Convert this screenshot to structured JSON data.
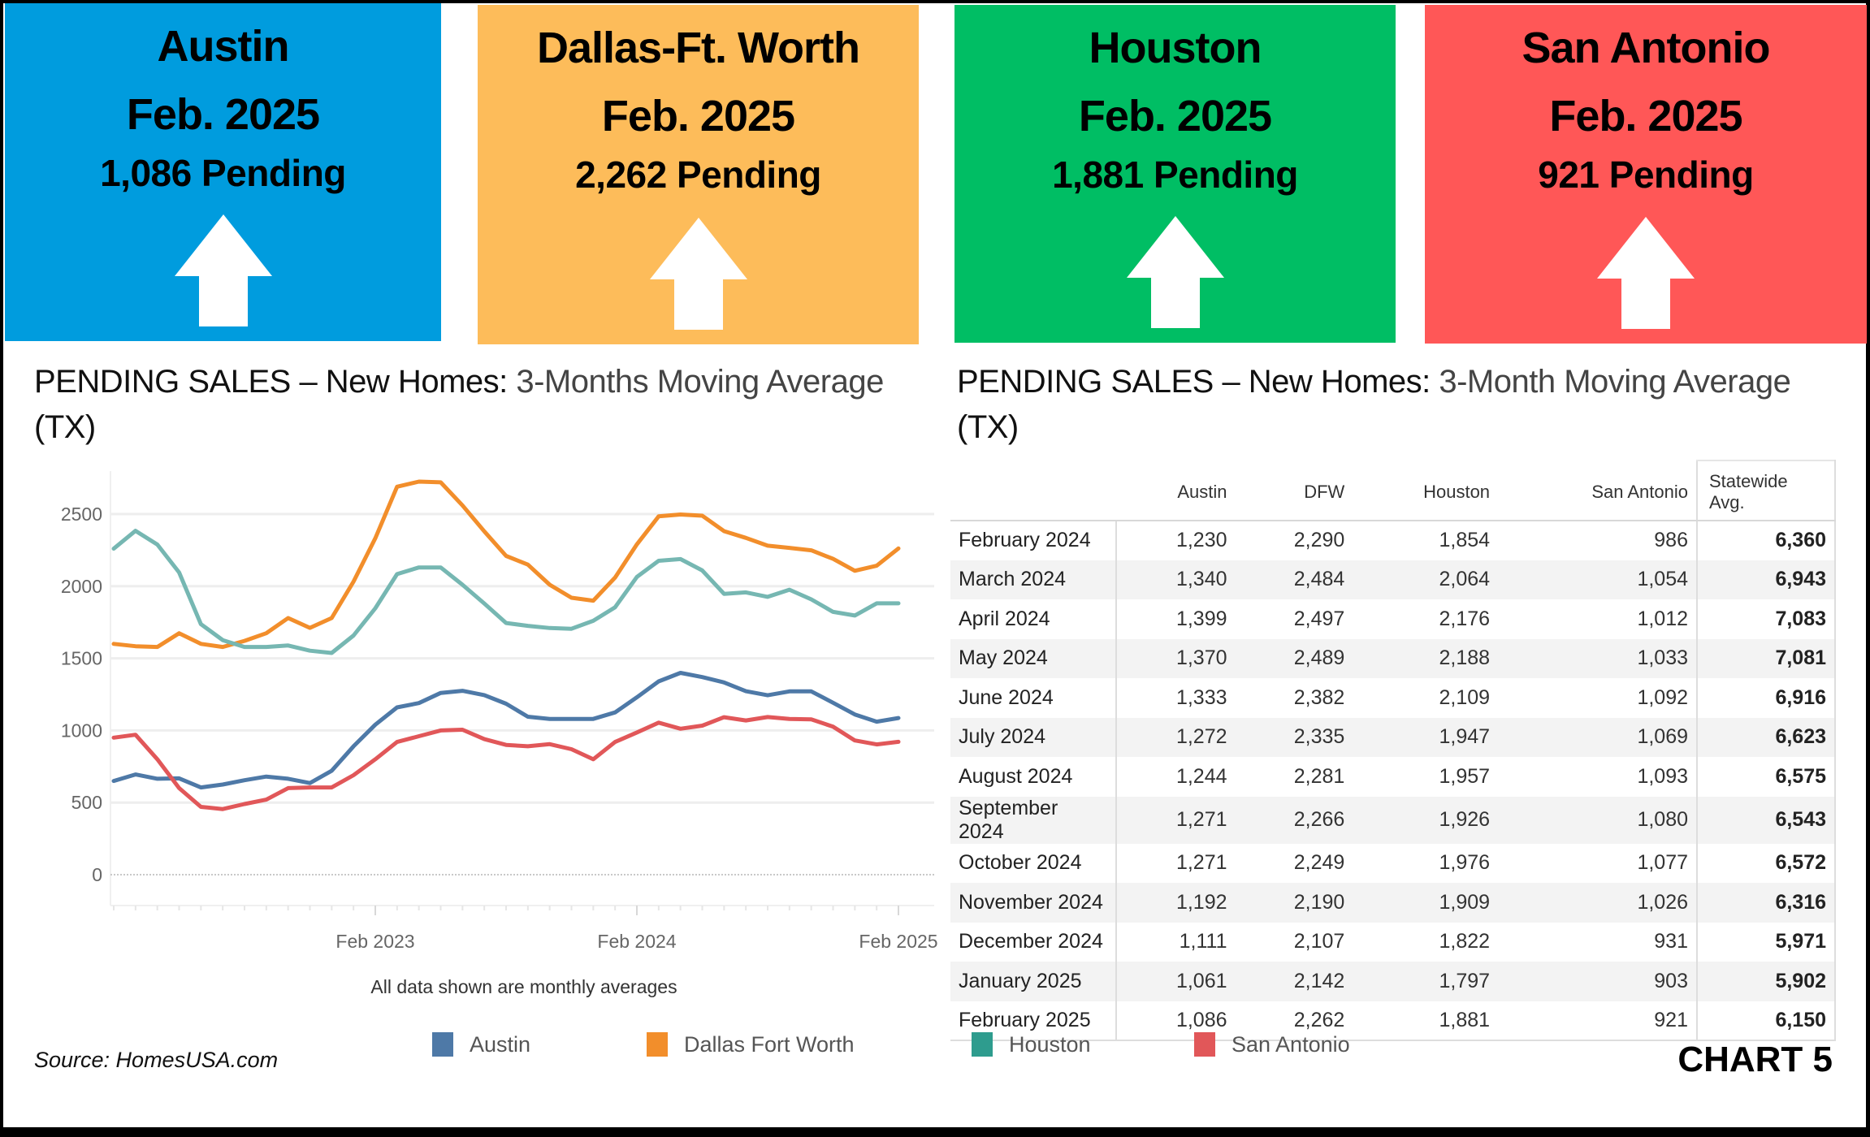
{
  "cards": [
    {
      "city": "Austin",
      "date": "Feb. 2025",
      "pending": "1,086 Pending",
      "color": "#009CDE",
      "trend": "up-arrow-icon"
    },
    {
      "city": "Dallas-Ft. Worth",
      "date": "Feb. 2025",
      "pending": "2,262 Pending",
      "color": "#FDBC5A",
      "trend": "up-arrow-icon"
    },
    {
      "city": "Houston",
      "date": "Feb. 2025",
      "pending": "1,881 Pending",
      "color": "#00BE64",
      "trend": "up-arrow-icon"
    },
    {
      "city": "San Antonio",
      "date": "Feb. 2025",
      "pending": "921 Pending",
      "color": "#FF5757",
      "trend": "up-arrow-icon"
    }
  ],
  "left_panel": {
    "title_bold": "PENDING SALES – New Homes:",
    "title_light": " 3-Months  Moving Average",
    "title_end": " (TX)",
    "note": "All data shown are monthly averages"
  },
  "right_panel": {
    "title_bold": "PENDING SALES – New Homes:",
    "title_light": "  3-Month Moving Average",
    "title_end": " (TX)"
  },
  "chart_data": {
    "type": "line",
    "title": "PENDING SALES – New Homes: 3-Months Moving Average (TX)",
    "xlabel": "",
    "ylabel": "",
    "note": "All data shown are monthly averages",
    "ylim": [
      0,
      2800
    ],
    "yticks": [
      0,
      500,
      1000,
      1500,
      2000,
      2500
    ],
    "xtick_labels": [
      "Feb 2023",
      "Feb 2024",
      "Feb 2025"
    ],
    "xtick_months": [
      "2023-02",
      "2024-02",
      "2025-02"
    ],
    "grid": true,
    "legend_position": "bottom",
    "x": [
      "2022-02",
      "2022-03",
      "2022-04",
      "2022-05",
      "2022-06",
      "2022-07",
      "2022-08",
      "2022-09",
      "2022-10",
      "2022-11",
      "2022-12",
      "2023-01",
      "2023-02",
      "2023-03",
      "2023-04",
      "2023-05",
      "2023-06",
      "2023-07",
      "2023-08",
      "2023-09",
      "2023-10",
      "2023-11",
      "2023-12",
      "2024-01",
      "2024-02",
      "2024-03",
      "2024-04",
      "2024-05",
      "2024-06",
      "2024-07",
      "2024-08",
      "2024-09",
      "2024-10",
      "2024-11",
      "2024-12",
      "2025-01",
      "2025-02"
    ],
    "series": [
      {
        "name": "Austin",
        "color": "#4E79A7",
        "values": [
          650,
          695,
          665,
          668,
          605,
          625,
          655,
          680,
          665,
          635,
          720,
          890,
          1040,
          1160,
          1190,
          1260,
          1275,
          1245,
          1185,
          1095,
          1080,
          1080,
          1080,
          1125,
          1230,
          1340,
          1399,
          1370,
          1333,
          1272,
          1244,
          1271,
          1271,
          1192,
          1111,
          1061,
          1086
        ]
      },
      {
        "name": "Dallas Fort Worth",
        "color": "#F28E2B",
        "values": [
          1600,
          1584,
          1579,
          1674,
          1600,
          1579,
          1621,
          1674,
          1779,
          1711,
          1779,
          2032,
          2332,
          2690,
          2725,
          2720,
          2560,
          2380,
          2210,
          2150,
          2010,
          1920,
          1900,
          2060,
          2290,
          2484,
          2497,
          2489,
          2382,
          2335,
          2281,
          2266,
          2249,
          2190,
          2107,
          2142,
          2262
        ]
      },
      {
        "name": "Houston",
        "color": "#76B7B2",
        "values": [
          2260,
          2384,
          2289,
          2095,
          1737,
          1626,
          1579,
          1579,
          1589,
          1553,
          1537,
          1658,
          1847,
          2084,
          2130,
          2130,
          2010,
          1880,
          1745,
          1725,
          1710,
          1705,
          1760,
          1854,
          2064,
          2176,
          2188,
          2109,
          1947,
          1957,
          1926,
          1976,
          1909,
          1822,
          1797,
          1881,
          1881
        ]
      },
      {
        "name": "San Antonio",
        "color": "#E15759",
        "values": [
          950,
          970,
          800,
          600,
          470,
          455,
          490,
          520,
          600,
          605,
          605,
          690,
          800,
          920,
          960,
          1000,
          1005,
          940,
          900,
          890,
          905,
          870,
          800,
          920,
          986,
          1054,
          1012,
          1033,
          1092,
          1069,
          1093,
          1080,
          1077,
          1026,
          931,
          903,
          921
        ]
      }
    ]
  },
  "table": {
    "columns": [
      "",
      "Austin",
      "DFW",
      "Houston",
      "San Antonio",
      "Statewide Avg."
    ],
    "rows": [
      {
        "month": "February 2024",
        "austin": "1,230",
        "dfw": "2,290",
        "houston": "1,854",
        "san_antonio": "986",
        "statewide": "6,360"
      },
      {
        "month": "March 2024",
        "austin": "1,340",
        "dfw": "2,484",
        "houston": "2,064",
        "san_antonio": "1,054",
        "statewide": "6,943"
      },
      {
        "month": "April 2024",
        "austin": "1,399",
        "dfw": "2,497",
        "houston": "2,176",
        "san_antonio": "1,012",
        "statewide": "7,083"
      },
      {
        "month": "May 2024",
        "austin": "1,370",
        "dfw": "2,489",
        "houston": "2,188",
        "san_antonio": "1,033",
        "statewide": "7,081"
      },
      {
        "month": "June 2024",
        "austin": "1,333",
        "dfw": "2,382",
        "houston": "2,109",
        "san_antonio": "1,092",
        "statewide": "6,916"
      },
      {
        "month": "July 2024",
        "austin": "1,272",
        "dfw": "2,335",
        "houston": "1,947",
        "san_antonio": "1,069",
        "statewide": "6,623"
      },
      {
        "month": "August 2024",
        "austin": "1,244",
        "dfw": "2,281",
        "houston": "1,957",
        "san_antonio": "1,093",
        "statewide": "6,575"
      },
      {
        "month": "September 2024",
        "austin": "1,271",
        "dfw": "2,266",
        "houston": "1,926",
        "san_antonio": "1,080",
        "statewide": "6,543"
      },
      {
        "month": "October 2024",
        "austin": "1,271",
        "dfw": "2,249",
        "houston": "1,976",
        "san_antonio": "1,077",
        "statewide": "6,572"
      },
      {
        "month": "November 2024",
        "austin": "1,192",
        "dfw": "2,190",
        "houston": "1,909",
        "san_antonio": "1,026",
        "statewide": "6,316"
      },
      {
        "month": "December 2024",
        "austin": "1,111",
        "dfw": "2,107",
        "houston": "1,822",
        "san_antonio": "931",
        "statewide": "5,971"
      },
      {
        "month": "January 2025",
        "austin": "1,061",
        "dfw": "2,142",
        "houston": "1,797",
        "san_antonio": "903",
        "statewide": "5,902"
      },
      {
        "month": "February 2025",
        "austin": "1,086",
        "dfw": "2,262",
        "houston": "1,881",
        "san_antonio": "921",
        "statewide": "6,150"
      }
    ]
  },
  "legend": [
    {
      "label": "Austin",
      "color": "#4E79A7"
    },
    {
      "label": "Dallas Fort Worth",
      "color": "#F28E2B"
    },
    {
      "label": "Houston",
      "color": "#2E9C8E"
    },
    {
      "label": "San Antonio",
      "color": "#E15759"
    }
  ],
  "footer": {
    "source": "Source: HomesUSA.com",
    "chart_id": "CHART 5"
  }
}
